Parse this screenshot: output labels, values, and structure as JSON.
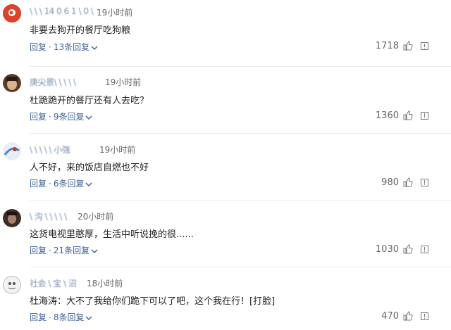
{
  "comments": [
    {
      "username": "\\ \\ \\ 14 0 6 1 \\ 0 \\",
      "time": "19小时前",
      "text": "非要去狗开的餐厅吃狗粮",
      "reply_label": "回复",
      "replies_label": "13条回复",
      "likes": "1718",
      "avatar_color": "#d9442b"
    },
    {
      "username": "庚尖景\\ \\ \\ \\ \\",
      "time": "19小时前",
      "text": "杜跪跪开的餐厅还有人去吃？",
      "reply_label": "回复",
      "replies_label": "9条回复",
      "likes": "1360",
      "avatar_color": "#5a3b2a"
    },
    {
      "username": "\\ \\ \\ \\ \\ 小强",
      "time": "19小时前",
      "text": "人不好，来的饭店自燃也不好",
      "reply_label": "回复",
      "replies_label": "6条回复",
      "likes": "980",
      "avatar_color": "#8fb6d9"
    },
    {
      "username": "\\ 沟 \\ \\ \\ \\ \\",
      "time": "20小时前",
      "text": "这货电视里憨厚，生活中听说挽的很......",
      "reply_label": "回复",
      "replies_label": "21条回复",
      "likes": "1030",
      "avatar_color": "#3b2b24"
    },
    {
      "username": "社会 \\ 宝 \\ 沼",
      "time": "18小时前",
      "text": "杜海涛：大不了我给你们跪下可以了吧，这个我在行！[打脸]",
      "reply_label": "回复",
      "replies_label": "8条回复",
      "likes": "470",
      "avatar_color": "#d8d8d8"
    }
  ],
  "icons": {
    "thumb": "thumbs-up-icon",
    "report": "report-icon",
    "chevron": "chevron-down-icon"
  },
  "colors": {
    "link": "#406599",
    "text": "#222222",
    "muted": "#666666"
  }
}
